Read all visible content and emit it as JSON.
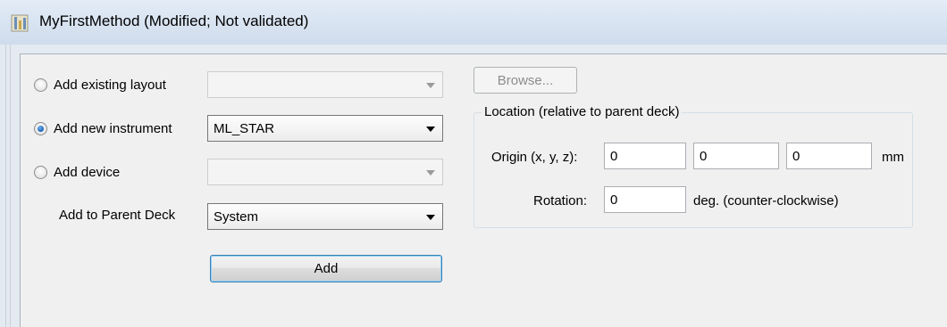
{
  "window": {
    "title": "MyFirstMethod (Modified; Not validated)",
    "icon": "app-icon"
  },
  "options": {
    "existing_layout_label": "Add existing layout",
    "new_instrument_label": "Add new instrument",
    "device_label": "Add device",
    "selected": "new_instrument"
  },
  "combos": {
    "existing_layout_value": "",
    "new_instrument_value": "ML_STAR",
    "device_value": "",
    "parent_deck_value": "System"
  },
  "parent_deck_label": "Add to Parent Deck",
  "buttons": {
    "add_label": "Add",
    "browse_label": "Browse..."
  },
  "location": {
    "group_title": "Location (relative to parent deck)",
    "origin_label": "Origin (x, y, z):",
    "origin_x": "0",
    "origin_y": "0",
    "origin_z": "0",
    "origin_unit": "mm",
    "rotation_label": "Rotation:",
    "rotation_value": "0",
    "rotation_unit": "deg. (counter-clockwise)"
  }
}
